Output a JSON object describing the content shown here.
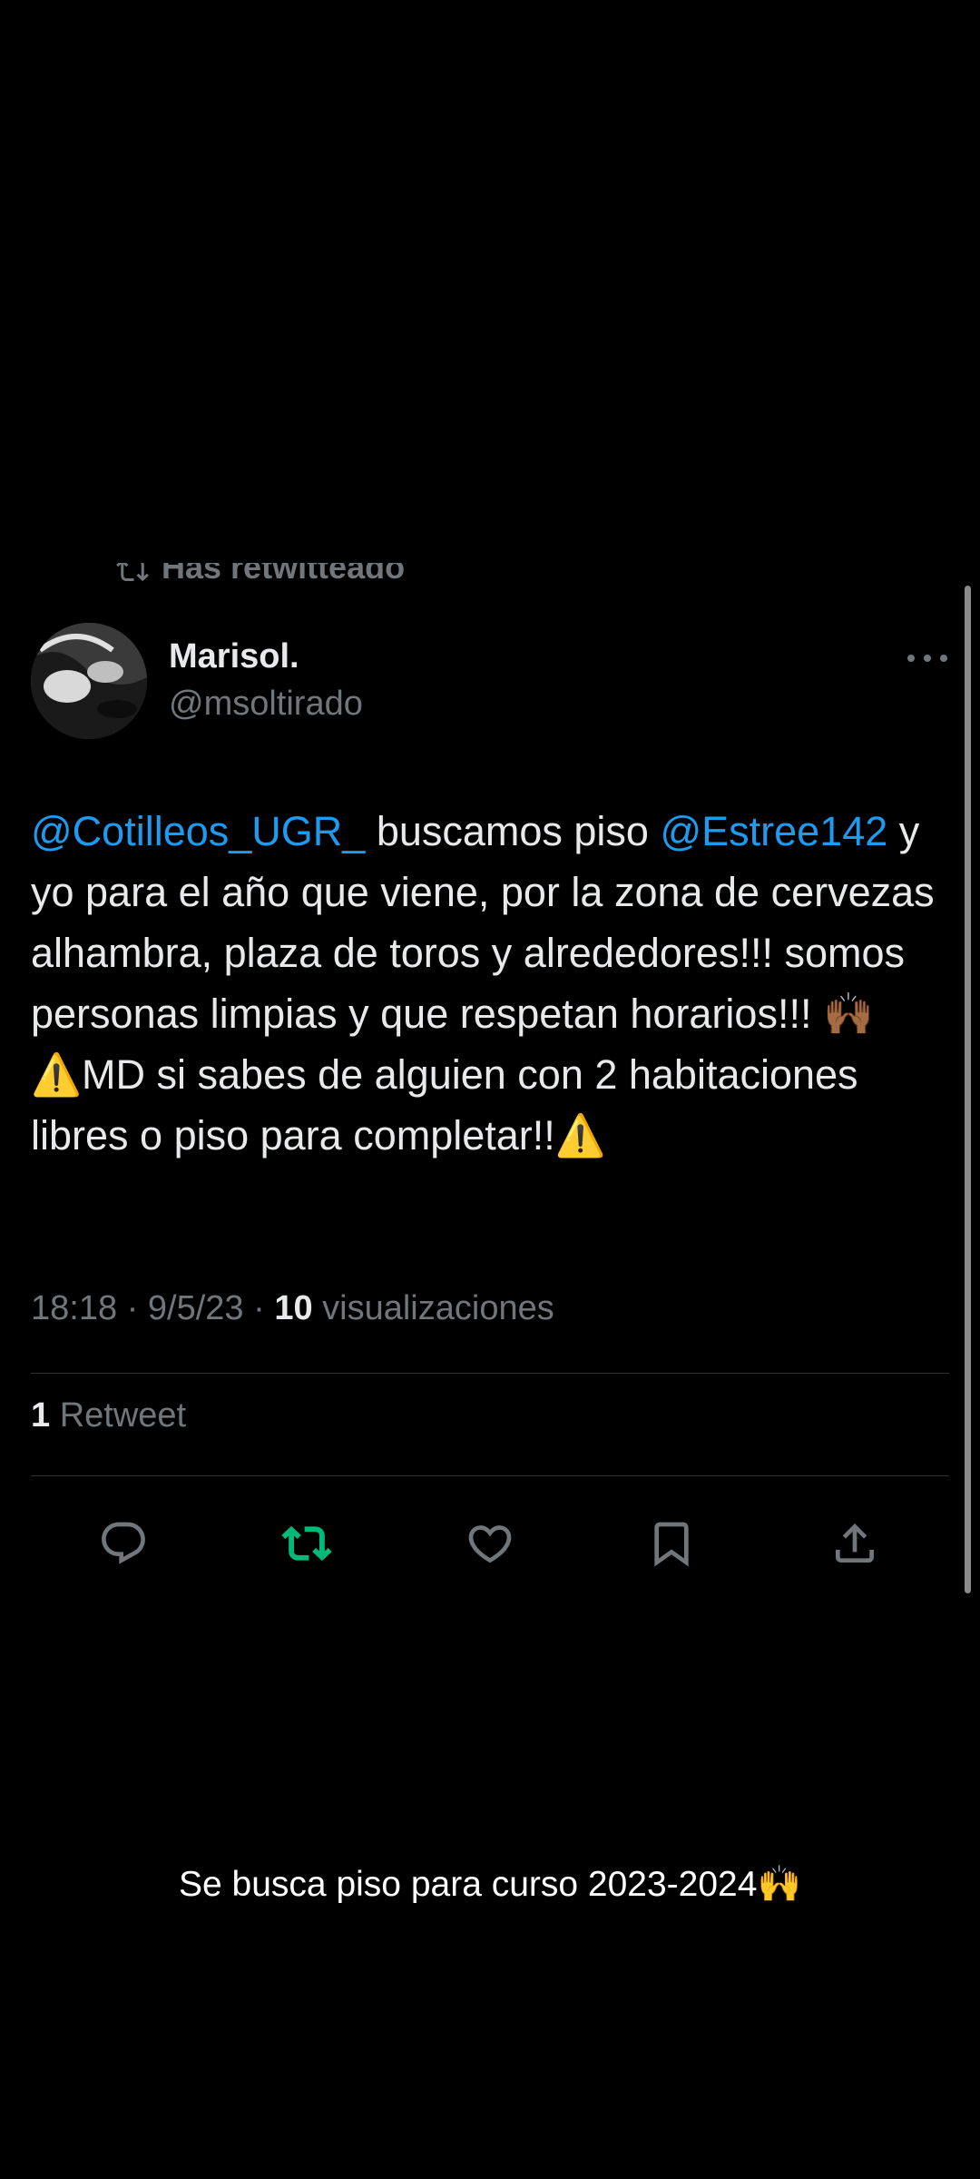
{
  "tweet": {
    "retweeted_label": "Has retwitteado",
    "author": {
      "name": "Marisol.",
      "handle": "@msoltirado"
    },
    "text_parts": {
      "mention1": "@Cotilleos_UGR_",
      "text1": " buscamos piso ",
      "mention2": "@Estree142",
      "text2": " y yo para el año que viene, por la zona de cervezas alhambra, plaza de toros y alrededores!!! somos personas limpias y que respetan horarios!!! ",
      "emoji1": "🙌🏾",
      "emoji2": "⚠️",
      "text3": "MD si sabes de alguien con 2 habitaciones libres o piso para completar!!",
      "emoji3": "⚠️"
    },
    "meta": {
      "time": "18:18",
      "date": "9/5/23",
      "views_count": "10",
      "views_label": "visualizaciones"
    },
    "stats": {
      "retweet_count": "1",
      "retweet_label": "Retweet"
    },
    "actions": [
      {
        "name": "reply-icon"
      },
      {
        "name": "retweet-icon",
        "color": "#00ba7c"
      },
      {
        "name": "like-icon"
      },
      {
        "name": "bookmark-icon"
      },
      {
        "name": "share-icon"
      }
    ]
  },
  "caption": {
    "text": "Se busca piso para curso 2023-2024",
    "emoji": "🙌"
  },
  "colors": {
    "background": "#000000",
    "text": "#e7e9ea",
    "muted": "#71767b",
    "mention": "#1d9bf0",
    "retweet_active": "#00ba7c",
    "divider": "#2f3336"
  }
}
